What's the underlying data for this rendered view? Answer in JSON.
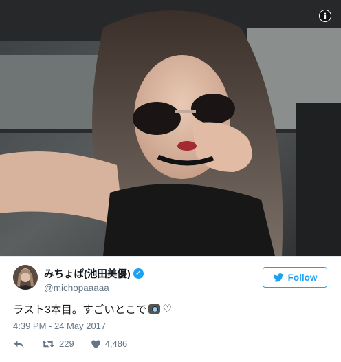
{
  "photo": {
    "info_icon": "info-icon",
    "info_glyph": "i"
  },
  "tweet": {
    "display_name": "みちょぱ(池田美優)",
    "verified_icon": "verified-badge-icon",
    "verified_glyph": "✓",
    "handle": "@michopaaaaa",
    "follow_label": "Follow",
    "follow_icon": "twitter-bird-icon",
    "text": "ラスト3本目。すごいとこで",
    "text_suffix": "♡",
    "camera_icon": "camera-emoji-icon",
    "timestamp": "4:39 PM - 24 May 2017",
    "actions": {
      "reply_icon": "reply-icon",
      "retweet_icon": "retweet-icon",
      "retweet_count": "229",
      "like_icon": "heart-icon",
      "like_count": "4,486"
    }
  },
  "colors": {
    "accent": "#1da1f2",
    "text": "#14171a",
    "muted": "#657786"
  }
}
